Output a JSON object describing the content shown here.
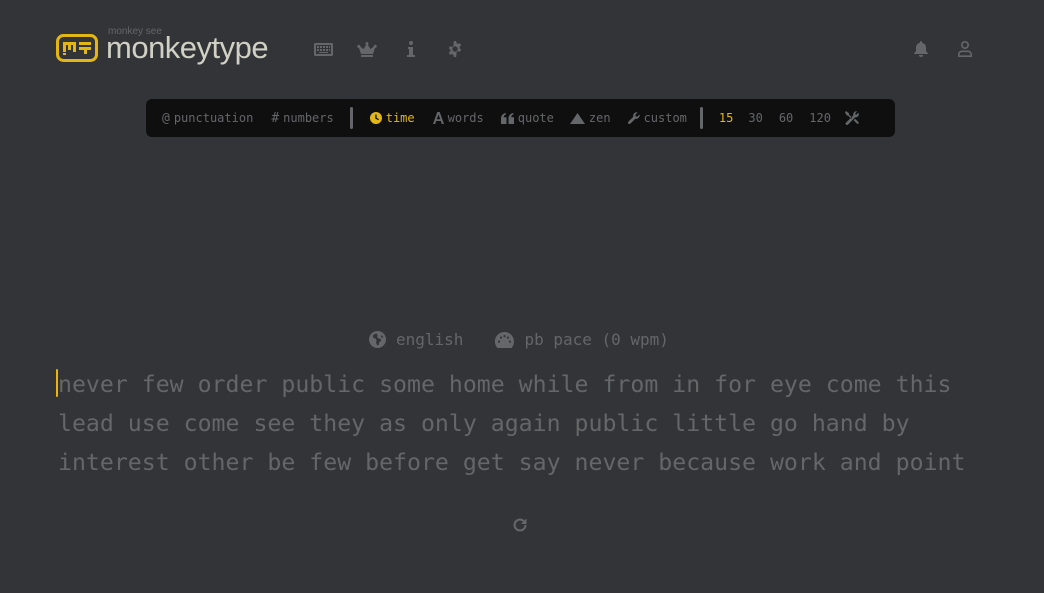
{
  "header": {
    "logo_small": "monkey see",
    "logo_big": "monkeytype",
    "nav_icons": [
      "keyboard-icon",
      "crown-icon",
      "info-icon",
      "gear-icon",
      "bell-icon",
      "user-icon"
    ]
  },
  "config": {
    "punctuation": "punctuation",
    "numbers": "numbers",
    "modes": [
      {
        "label": "time",
        "active": true
      },
      {
        "label": "words",
        "active": false
      },
      {
        "label": "quote",
        "active": false
      },
      {
        "label": "zen",
        "active": false
      },
      {
        "label": "custom",
        "active": false
      }
    ],
    "durations": [
      {
        "label": "15",
        "active": true
      },
      {
        "label": "30",
        "active": false
      },
      {
        "label": "60",
        "active": false
      },
      {
        "label": "120",
        "active": false
      }
    ]
  },
  "info": {
    "language": "english",
    "pace": "pb pace (0 wpm)"
  },
  "words": {
    "line1": "never few order public some home while from in for eye come this",
    "line2": "lead use come see they as only again public little go hand by",
    "line3": "interest other be few before get say never because work and point"
  },
  "colors": {
    "background": "#323437",
    "accent": "#e2b714",
    "sub": "#646669",
    "text": "#d1d0c5",
    "bar": "#0f0f10"
  }
}
